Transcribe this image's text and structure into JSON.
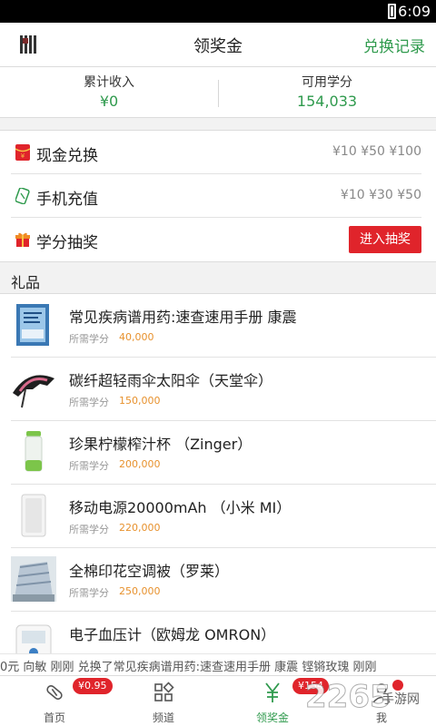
{
  "status_bar": {
    "time": "6:09"
  },
  "header": {
    "title": "领奖金",
    "redeem_link": "兑换记录"
  },
  "stats": [
    {
      "label": "累计收入",
      "value": "¥0"
    },
    {
      "label": "可用学分",
      "value": "154,033"
    }
  ],
  "menu": [
    {
      "label": "现金兑换",
      "values": "¥10 ¥50 ¥100",
      "icon": "red-envelope-icon"
    },
    {
      "label": "手机充值",
      "values": "¥10 ¥30 ¥50",
      "icon": "recharge-card-icon"
    },
    {
      "label": "学分抽奖",
      "button": "进入抽奖",
      "icon": "gift-box-icon"
    }
  ],
  "gifts_section": {
    "title": "礼品"
  },
  "gifts": [
    {
      "name": "常见疾病谱用药:速查速用手册 康震",
      "need_label": "所需学分",
      "points": "40,000"
    },
    {
      "name": "碳纤超轻雨伞太阳伞（天堂伞）",
      "need_label": "所需学分",
      "points": "150,000"
    },
    {
      "name": "珍果柠檬榨汁杯 （Zinger）",
      "need_label": "所需学分",
      "points": "200,000"
    },
    {
      "name": "移动电源20000mAh （小米 MI）",
      "need_label": "所需学分",
      "points": "220,000"
    },
    {
      "name": "全棉印花空调被（罗莱）",
      "need_label": "所需学分",
      "points": "250,000"
    },
    {
      "name": "电子血压计（欧姆龙 OMRON）",
      "need_label": "所需学分",
      "points": ""
    }
  ],
  "ticker": {
    "text": "0元  向敏 刚刚 兑换了常见疾病谱用药:速查速用手册 康震  铿锵玫瑰 刚刚"
  },
  "tabs": [
    {
      "label": "首页",
      "badge": "¥0.95",
      "icon": "pill-icon"
    },
    {
      "label": "频道",
      "icon": "grid-icon"
    },
    {
      "label": "领奖金",
      "badge": "¥154",
      "icon": "yuan-icon",
      "active": true
    },
    {
      "label": "我",
      "icon": "user-icon"
    }
  ],
  "watermark": {
    "number": "2265",
    "site": "手游网"
  },
  "colors": {
    "accent_green": "#2f9a4d",
    "red": "#e0242b",
    "points_orange": "#e7912d"
  }
}
